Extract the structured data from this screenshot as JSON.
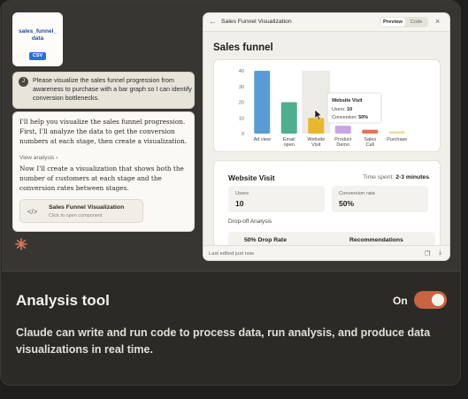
{
  "colors": {
    "accent": "#c96442",
    "bar_ad_view": "#5b9bd5",
    "bar_email_open": "#4fae8e",
    "bar_website_visit": "#e8b730",
    "bar_product_demo": "#c9a5e6",
    "bar_sales_call": "#e0735a",
    "bar_purchase": "#f0d9a0"
  },
  "file": {
    "name": "sales_funnel_ data",
    "type": "CSV"
  },
  "chat": {
    "user_initial": "J",
    "user_message": "Please visualize the sales funnel progression from awareness to purchase with a bar graph so I can identify conversion bottlenecks.",
    "reply_para1": "I'll help you visualize the sales funnel progression. First, I'll analyze the data to get the conversion numbers at each stage, then create a visualization.",
    "view_analysis": "View analysis  ›",
    "reply_para2": "Now I'll create a visualization that shows both the number of customers at each stage and the conversion rates between stages.",
    "component_title": "Sales Funnel Visualization",
    "component_subtitle": "Click to open component",
    "component_icon": "code-icon"
  },
  "artifact": {
    "title": "Sales Funnel Visualization",
    "tab_preview": "Preview",
    "tab_code": "Code",
    "heading": "Sales funnel",
    "tooltip": {
      "title": "Website Visit",
      "users_label": "Users:",
      "users_value": "10",
      "conversion_label": "Conversion:",
      "conversion_value": "50%"
    },
    "visit_title": "Website Visit",
    "time_spent_label": "Time spent:",
    "time_spent_value": "2-3 minutes",
    "users_label": "Users",
    "users_value": "10",
    "conversion_label": "Conversion rate",
    "conversion_value": "50%",
    "dropoff_label": "Drop-off Analysis",
    "drop_rate": "50% Drop Rate",
    "recommendations": "Recommendations",
    "last_edited": "Last edited just now"
  },
  "chart_data": {
    "type": "bar",
    "categories": [
      "Ad view",
      "Email open",
      "Website Visit",
      "Product Demo",
      "Sales Call",
      "Purchase"
    ],
    "tick_labels": [
      [
        "Ad view"
      ],
      [
        "Email",
        "open"
      ],
      [
        "Website",
        "Visit"
      ],
      [
        "Product",
        "Demo"
      ],
      [
        "Sales",
        "Call"
      ],
      [
        "Purchase"
      ]
    ],
    "values": [
      40,
      20,
      10,
      5,
      2.5,
      1.5
    ],
    "ylim": [
      0,
      40
    ],
    "yticks": [
      0,
      10,
      20,
      30,
      40
    ],
    "highlighted": "Website Visit",
    "grid": false
  },
  "feature": {
    "title": "Analysis tool",
    "description": "Claude can write and run code to process data, run analysis, and produce data visualizations in real time.",
    "toggle_label": "On",
    "toggle_on": true
  }
}
